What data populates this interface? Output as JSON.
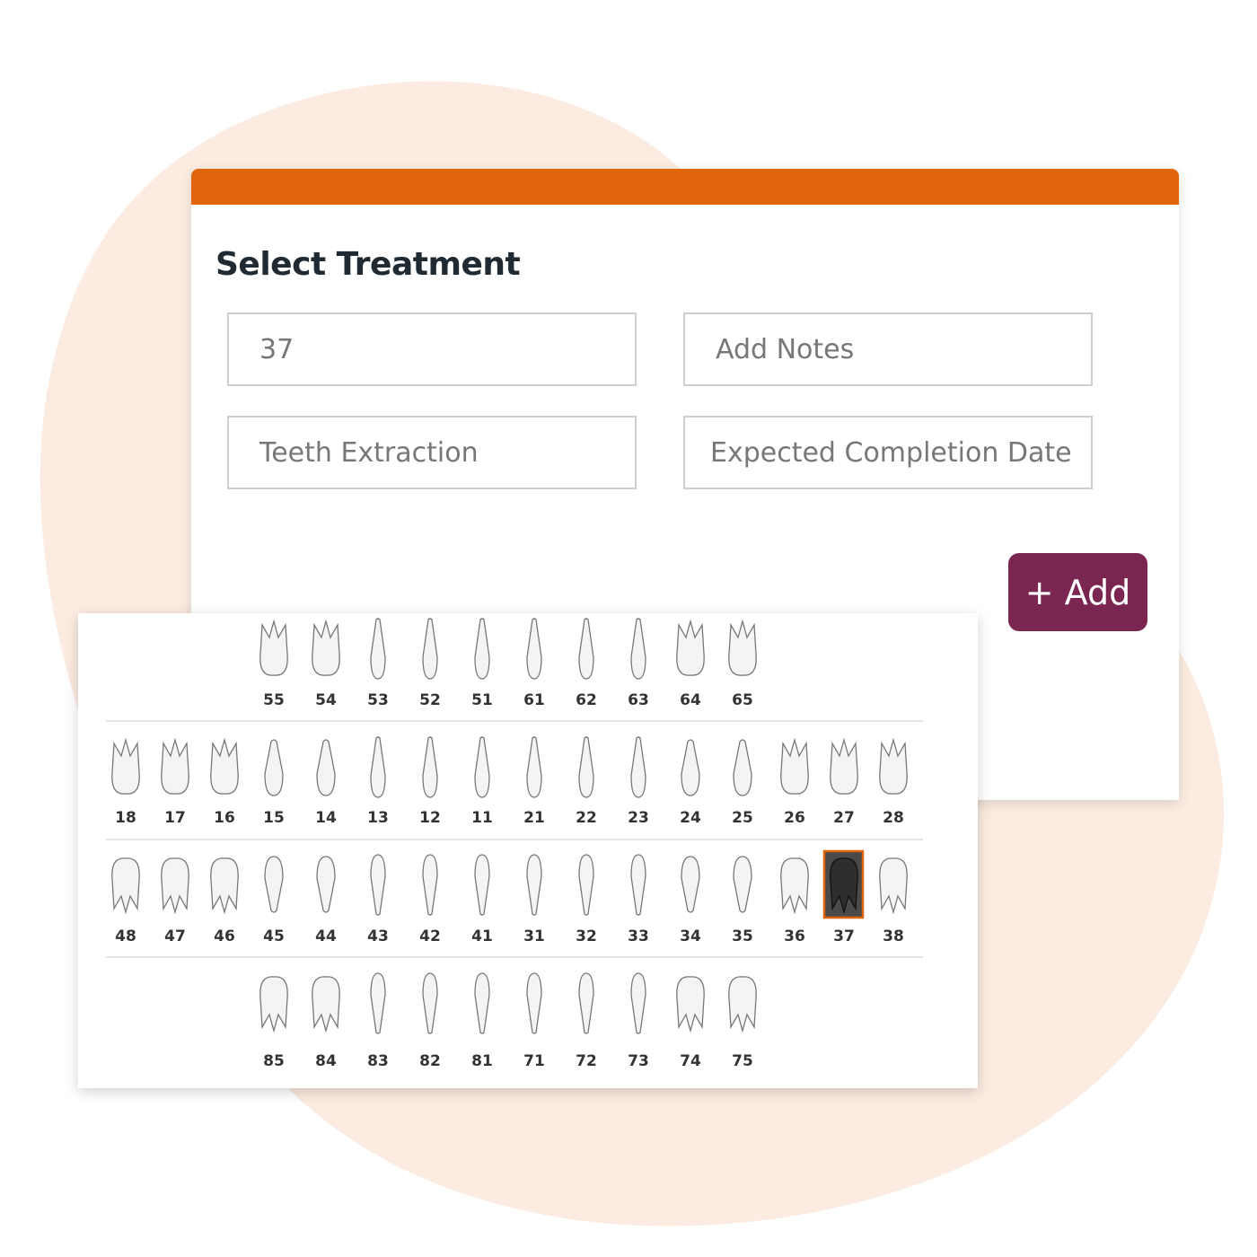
{
  "colors": {
    "accent_bar": "#e0640a",
    "add_button": "#7a2650",
    "background_blob": "#fbebe0",
    "selected_tooth": "#4a4a4a",
    "selected_border": "#e0640a"
  },
  "form": {
    "title": "Select Treatment",
    "tooth_field": {
      "value": "37"
    },
    "notes_field": {
      "placeholder": "Add Notes"
    },
    "treatment_field": {
      "value": "Teeth Extraction"
    },
    "date_field": {
      "placeholder": "Expected Completion Date"
    },
    "add_button": {
      "icon": "plus-icon",
      "label": "+ Add"
    }
  },
  "tooth_chart": {
    "selected": "37",
    "rows": [
      [
        "55",
        "54",
        "53",
        "52",
        "51",
        "61",
        "62",
        "63",
        "64",
        "65"
      ],
      [
        "18",
        "17",
        "16",
        "15",
        "14",
        "13",
        "12",
        "11",
        "21",
        "22",
        "23",
        "24",
        "25",
        "26",
        "27",
        "28"
      ],
      [
        "48",
        "47",
        "46",
        "45",
        "44",
        "43",
        "42",
        "41",
        "31",
        "32",
        "33",
        "34",
        "35",
        "36",
        "37",
        "38"
      ],
      [
        "85",
        "84",
        "83",
        "82",
        "81",
        "71",
        "72",
        "73",
        "74",
        "75"
      ]
    ]
  }
}
